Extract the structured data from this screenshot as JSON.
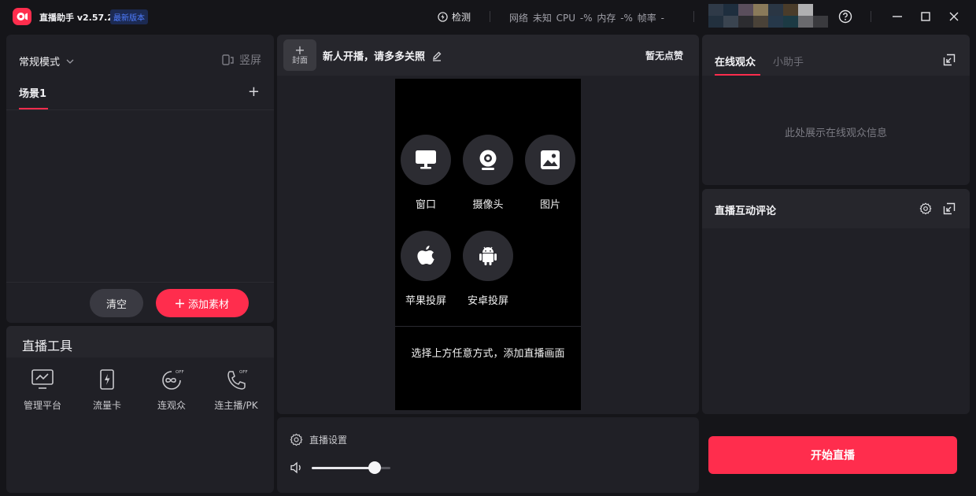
{
  "titlebar": {
    "app_title": "直播助手 v2.57.2",
    "version_badge": "最新版本",
    "detect_label": "检测",
    "stats": "网络 未知 CPU -% 内存 -% 帧率 -"
  },
  "left_panel": {
    "mode_label": "常规模式",
    "portrait_label": "竖屏",
    "scene_tab": "场景1",
    "clear_button": "清空",
    "add_material_button": "添加素材"
  },
  "tools": {
    "title": "直播工具",
    "items": [
      {
        "label": "管理平台",
        "icon": "monitor-chart-icon"
      },
      {
        "label": "流量卡",
        "icon": "lightning-card-icon"
      },
      {
        "label": "连观众",
        "icon": "link-audience-icon"
      },
      {
        "label": "连主播/PK",
        "icon": "phone-pk-icon"
      }
    ]
  },
  "center": {
    "cover_label": "封面",
    "live_title": "新人开播，请多多关照",
    "likes": "暂无点赞",
    "sources": [
      {
        "label": "窗口",
        "icon": "monitor-icon"
      },
      {
        "label": "摄像头",
        "icon": "camera-icon"
      },
      {
        "label": "图片",
        "icon": "image-icon"
      },
      {
        "label": "苹果投屏",
        "icon": "apple-icon"
      },
      {
        "label": "安卓投屏",
        "icon": "android-icon"
      }
    ],
    "hint": "选择上方任意方式，添加直播画面"
  },
  "bottom_bar": {
    "settings_label": "直播设置",
    "volume_level": 0.8,
    "start_button": "开始直播"
  },
  "right_panel": {
    "tab_online": "在线观众",
    "tab_assistant": "小助手",
    "empty_hint": "此处展示在线观众信息",
    "comments_title": "直播互动评论"
  },
  "colors": {
    "accent": "#ff2d4d",
    "panel": "#202026",
    "background": "#151519",
    "badge_blue": "#4f7dff"
  }
}
